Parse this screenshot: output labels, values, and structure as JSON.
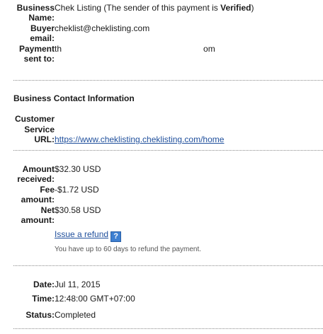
{
  "business": {
    "name_label": "Business Name:",
    "name_value": "Chek Listing",
    "sender_prefix": " (The sender of this payment is ",
    "sender_status": "Verified",
    "sender_suffix": ")",
    "buyer_email_label": "Buyer email:",
    "buyer_email_value": "cheklist@cheklisting.com",
    "payment_sent_to_label": "Payment sent to:",
    "payment_sent_to_start": "th",
    "payment_sent_to_end": "om"
  },
  "contact": {
    "heading": "Business Contact Information",
    "customer_service_label": "Customer Service URL:",
    "customer_service_url": "https://www.cheklisting.cheklisting.com/home"
  },
  "amounts": {
    "received_label": "Amount received:",
    "received_value": "$32.30 USD",
    "fee_label": "Fee amount:",
    "fee_value": "-$1.72 USD",
    "net_label": "Net amount:",
    "net_value": "$30.58 USD",
    "refund_link": "Issue a refund",
    "help_icon_glyph": "?",
    "refund_note": "You have up to 60 days to refund the payment."
  },
  "details": {
    "date_label": "Date:",
    "date_value": "Jul 11, 2015",
    "time_label": "Time:",
    "time_value": "12:48:00 GMT+07:00",
    "status_label": "Status:",
    "status_value": "Completed"
  },
  "colors": {
    "link": "#1f4f9c",
    "help_icon": "#3d7fd1",
    "divider": "#8a8a8a"
  }
}
